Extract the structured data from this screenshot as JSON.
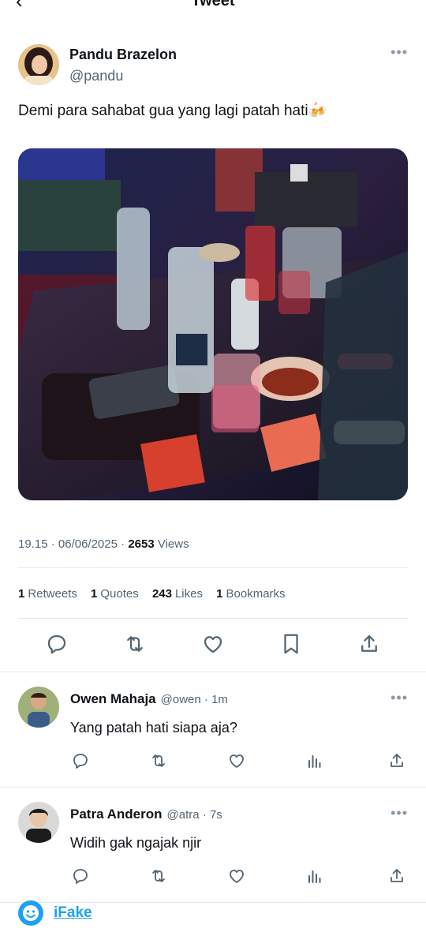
{
  "header": {
    "title": "Tweet"
  },
  "tweet": {
    "author_name": "Pandu Brazelon",
    "author_handle": "@pandu",
    "text": "Demi para sahabat gua yang lagi patah hati🍻",
    "time": "19.15",
    "date": "06/06/2025",
    "views_count": "2653",
    "views_label": "Views",
    "stats": [
      {
        "num": "1",
        "label": "Retweets"
      },
      {
        "num": "1",
        "label": "Quotes"
      },
      {
        "num": "243",
        "label": "Likes"
      },
      {
        "num": "1",
        "label": "Bookmarks"
      }
    ]
  },
  "replies": [
    {
      "name": "Owen Mahaja",
      "handle": "@owen",
      "time": "1m",
      "text": "Yang patah hati siapa aja?"
    },
    {
      "name": "Patra Anderon",
      "handle": "@atra",
      "time": "7s",
      "text": "Widih gak ngajak njir"
    }
  ],
  "watermark": {
    "text": "iFake"
  },
  "colors": {
    "accent": "#1da1f2",
    "text": "#0f1419",
    "muted": "#536471",
    "divider": "#e1e8ed"
  }
}
